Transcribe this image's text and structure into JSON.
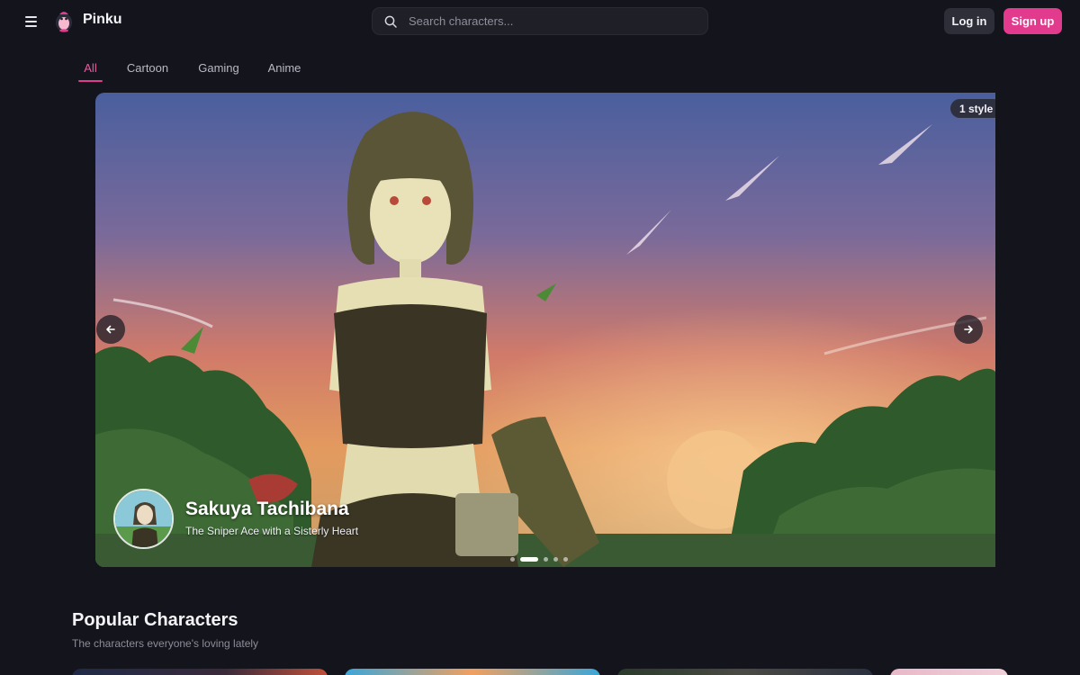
{
  "header": {
    "brand": "Pinku",
    "search_placeholder": "Search characters...",
    "login_label": "Log in",
    "signup_label": "Sign up",
    "accent_color": "#e23a8c"
  },
  "tabs": [
    {
      "label": "All",
      "active": true
    },
    {
      "label": "Cartoon",
      "active": false
    },
    {
      "label": "Gaming",
      "active": false
    },
    {
      "label": "Anime",
      "active": false
    }
  ],
  "hero": {
    "style_badge": "1 style",
    "character_name": "Sakuya Tachibana",
    "character_tagline": "The Sniper Ace with a Sisterly Heart",
    "carousel_dots": 5,
    "active_dot": 1
  },
  "popular": {
    "title": "Popular Characters",
    "subtitle": "The characters everyone's loving lately"
  },
  "icons": [
    "menu-icon",
    "pinku-logo",
    "search-icon",
    "arrow-left-icon",
    "arrow-right-icon"
  ]
}
